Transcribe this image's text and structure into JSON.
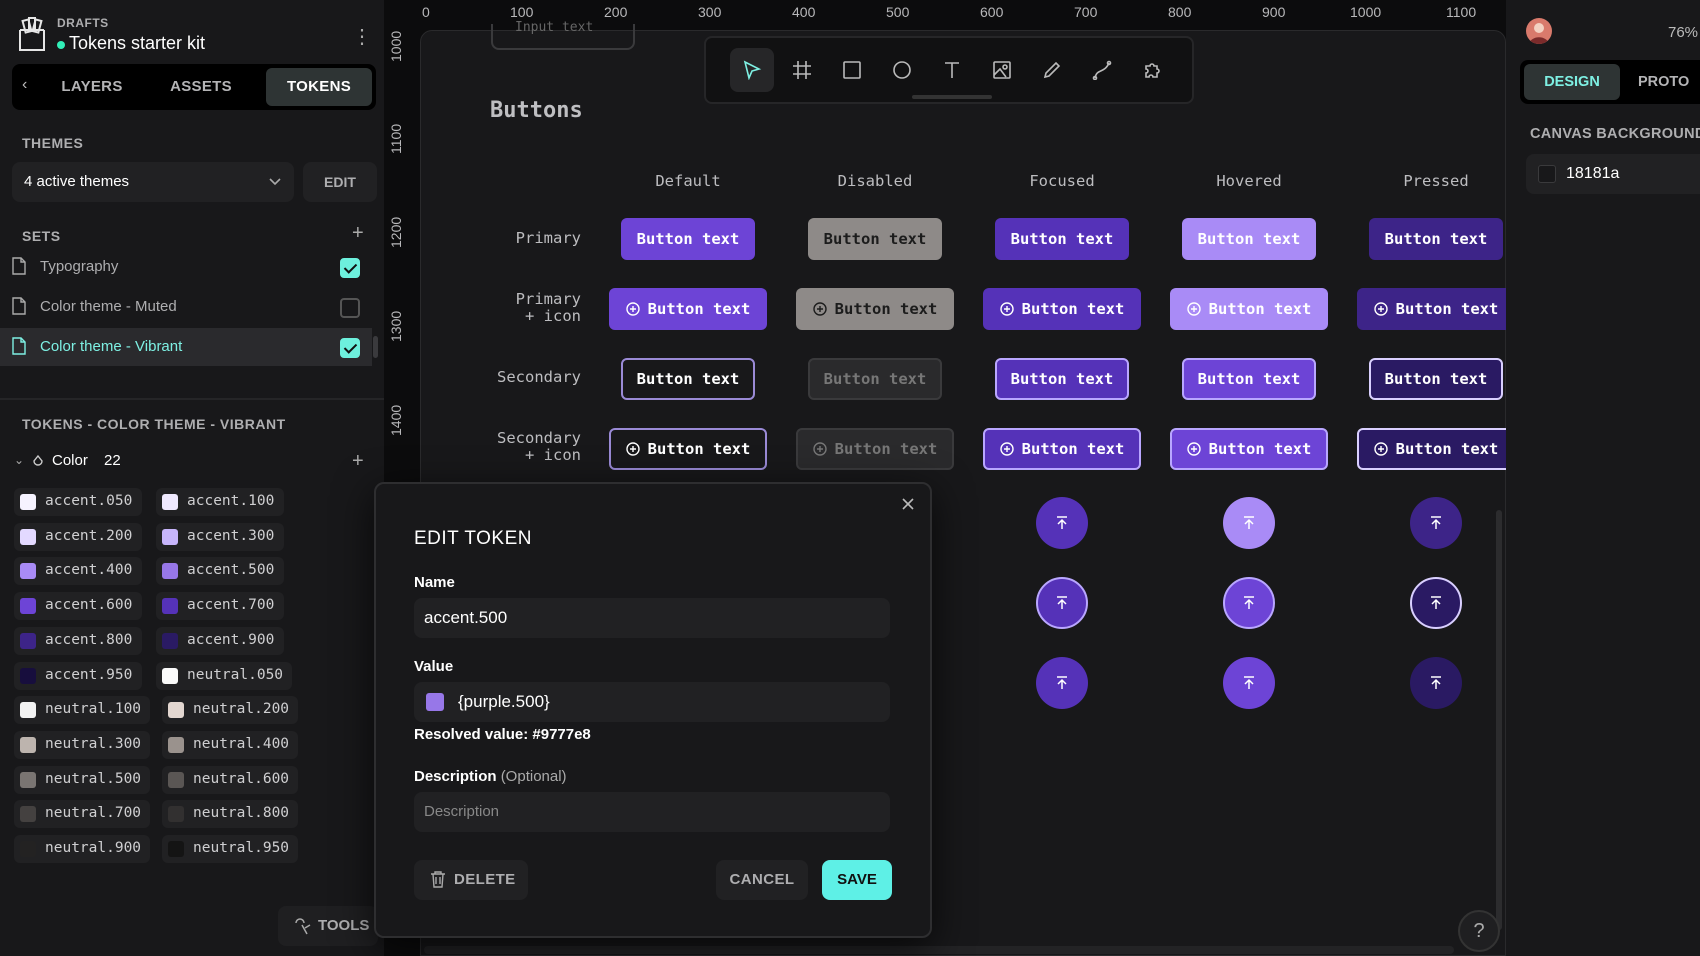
{
  "project": {
    "section": "DRAFTS",
    "name": "Tokens starter kit"
  },
  "left_tabs": [
    "LAYERS",
    "ASSETS",
    "TOKENS"
  ],
  "themes": {
    "title": "THEMES",
    "selected": "4 active themes",
    "edit_label": "EDIT"
  },
  "sets": {
    "title": "SETS",
    "items": [
      {
        "label": "Typography",
        "checked": true
      },
      {
        "label": "Color theme - Muted",
        "checked": false
      },
      {
        "label": "Color theme - Vibrant",
        "checked": true
      }
    ]
  },
  "tokens": {
    "title": "TOKENS - COLOR THEME - VIBRANT",
    "group_label": "Color",
    "group_count": "22",
    "items": [
      {
        "name": "accent.050",
        "color": "#f6f3ff"
      },
      {
        "name": "accent.100",
        "color": "#efe9ff"
      },
      {
        "name": "accent.200",
        "color": "#e3d9ff"
      },
      {
        "name": "accent.300",
        "color": "#c7b5fb"
      },
      {
        "name": "accent.400",
        "color": "#a98bf6"
      },
      {
        "name": "accent.500",
        "color": "#9777e8"
      },
      {
        "name": "accent.600",
        "color": "#6d44d6"
      },
      {
        "name": "accent.700",
        "color": "#5532b8"
      },
      {
        "name": "accent.800",
        "color": "#3d2488"
      },
      {
        "name": "accent.900",
        "color": "#2a1a63"
      },
      {
        "name": "accent.950",
        "color": "#170e3d"
      },
      {
        "name": "neutral.050",
        "color": "#fafafa"
      },
      {
        "name": "neutral.100",
        "color": "#f2f2f2"
      },
      {
        "name": "neutral.200",
        "color": "#e2d6d0"
      },
      {
        "name": "neutral.300",
        "color": "#bdb4ae"
      },
      {
        "name": "neutral.400",
        "color": "#9a928d"
      },
      {
        "name": "neutral.500",
        "color": "#7a7572"
      },
      {
        "name": "neutral.600",
        "color": "#5a5654"
      },
      {
        "name": "neutral.700",
        "color": "#444140"
      },
      {
        "name": "neutral.800",
        "color": "#323030"
      },
      {
        "name": "neutral.900",
        "color": "#232222"
      },
      {
        "name": "neutral.950",
        "color": "#141414"
      }
    ]
  },
  "tools_label": "TOOLS",
  "ruler_top": [
    "0",
    "100",
    "200",
    "300",
    "400",
    "500",
    "600",
    "700",
    "800",
    "900",
    "1000",
    "1100"
  ],
  "ruler_left": [
    "1000",
    "1100",
    "1200",
    "1300",
    "1400"
  ],
  "canvas": {
    "input_stub_text": "Input text",
    "section_title": "Buttons",
    "columns": [
      "Default",
      "Disabled",
      "Focused",
      "Hovered",
      "Pressed"
    ],
    "rows": [
      "Primary",
      "Primary\n+ icon",
      "Secondary",
      "Secondary\n+ icon"
    ],
    "button_text": "Button text"
  },
  "colors": {
    "primary_default": "#6d44d6",
    "disabled": "#8e8a88",
    "focused": "#5532b8",
    "hovered": "#a98bf6",
    "pressed": "#3d2488",
    "accent_cyan": "#5ef0e6"
  },
  "right_panel": {
    "zoom": "76%",
    "tabs": [
      "DESIGN",
      "PROTO"
    ],
    "section": "CANVAS BACKGROUND",
    "bg_value": "18181a"
  },
  "modal": {
    "title": "EDIT TOKEN",
    "name_label": "Name",
    "name_value": "accent.500",
    "value_label": "Value",
    "value_value": "{purple.500}",
    "resolved": "Resolved value: #9777e8",
    "desc_label": "Description",
    "desc_optional": "(Optional)",
    "desc_placeholder": "Description",
    "delete_label": "DELETE",
    "cancel_label": "CANCEL",
    "save_label": "SAVE"
  }
}
